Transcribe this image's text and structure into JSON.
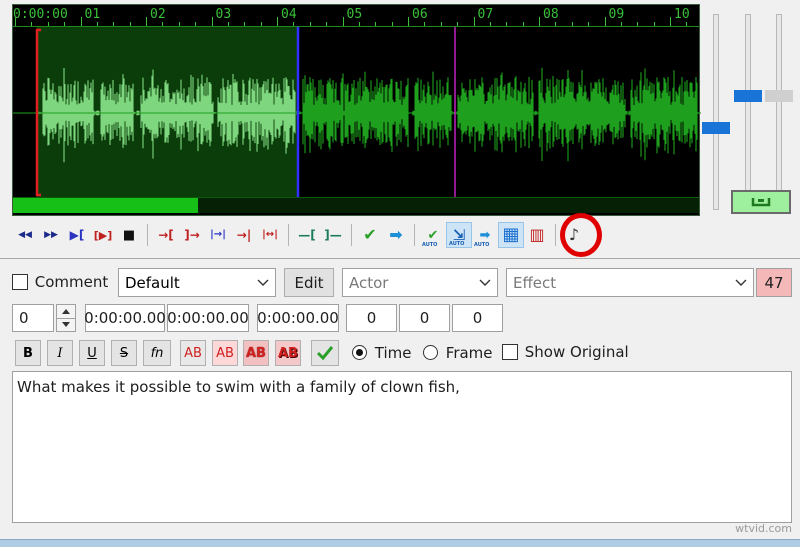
{
  "timeline": {
    "labels": [
      "0:00:00",
      "01",
      "02",
      "03",
      "04",
      "05",
      "06",
      "07",
      "08",
      "09",
      "10"
    ]
  },
  "waveform": {
    "selection_color": "#0b3d0b",
    "wave_selected_color": "#7fd67f",
    "wave_color": "#1ea01e",
    "start_marker_color": "#e02020",
    "end_marker_color": "#3030ff",
    "cursor_color": "#c020c0",
    "playback_progress": 0.27
  },
  "sliders": {
    "levels": [
      0.58,
      0.42,
      0.42
    ]
  },
  "toolbar": {
    "icons": [
      "rewind-icon",
      "fast-forward-icon",
      "play-selection-icon",
      "play-selection-loop-icon",
      "stop-icon",
      "sep",
      "play-before-start-icon",
      "play-after-start-icon",
      "play-before-end-icon",
      "play-after-end-icon",
      "play-around-icon",
      "sep",
      "set-start-icon",
      "set-end-icon",
      "sep",
      "commit-icon",
      "next-line-icon",
      "sep",
      "auto-commit-icon",
      "auto-scroll-icon",
      "auto-next-icon",
      "spectrum-icon",
      "video-icon",
      "sep",
      "karaoke-icon"
    ],
    "auto_tag": "AUTO"
  },
  "editor": {
    "comment_label": "Comment",
    "style_value": "Default",
    "edit_label": "Edit",
    "actor_placeholder": "Actor",
    "effect_placeholder": "Effect",
    "char_count": "47",
    "layer_value": "0",
    "start_time": "0:00:00.00",
    "end_time": "0:00:00.00",
    "duration": "0:00:00.00",
    "margin_left": "0",
    "margin_right": "0",
    "margin_vert": "0",
    "bold_label": "B",
    "italic_label": "I",
    "underline_label": "U",
    "strike_label": "S",
    "font_label": "fn",
    "color_label": "AB",
    "time_label": "Time",
    "frame_label": "Frame",
    "show_original_label": "Show Original",
    "text": "What makes it possible to swim with a family of clown fish,"
  },
  "colors": {
    "highlight_circle": "#e00000",
    "char_count_bg": "#f5b8b8"
  },
  "watermark": "wtvid.com"
}
